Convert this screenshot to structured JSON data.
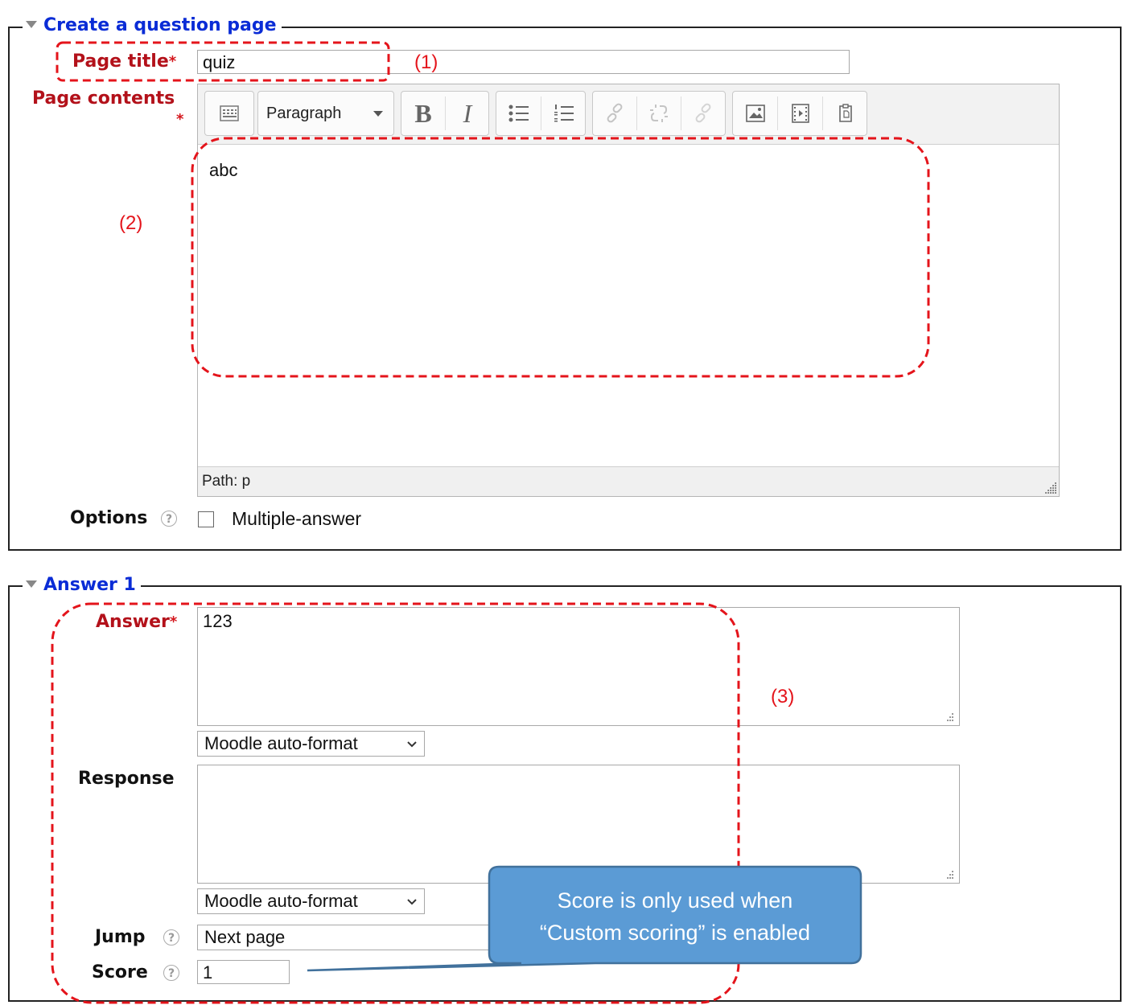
{
  "section1": {
    "legend": "Create a question page",
    "page_title_label": "Page title",
    "page_title_value": "quiz",
    "page_contents_label": "Page contents",
    "required_mark": "*",
    "editor": {
      "format_select": "Paragraph",
      "bold": "B",
      "italic": "I",
      "content": "abc",
      "path": "Path: p"
    },
    "options_label": "Options",
    "multiple_answer_label": "Multiple-answer"
  },
  "section2": {
    "legend": "Answer 1",
    "answer_label": "Answer",
    "answer_value": "123",
    "answer_format": "Moodle auto-format",
    "response_label": "Response",
    "response_value": "",
    "response_format": "Moodle auto-format",
    "jump_label": "Jump",
    "jump_value": "Next page",
    "score_label": "Score",
    "score_value": "1"
  },
  "annotations": {
    "a1": "(1)",
    "a2": "(2)",
    "a3": "(3)",
    "callout_line1": "Score is only used when",
    "callout_line2": "“Custom scoring” is enabled"
  },
  "colors": {
    "legend_blue": "#0a2cd6",
    "label_red": "#b3111a",
    "annotation_red": "#e4141b",
    "callout_fill": "#5b9bd5",
    "callout_border": "#41719c"
  }
}
